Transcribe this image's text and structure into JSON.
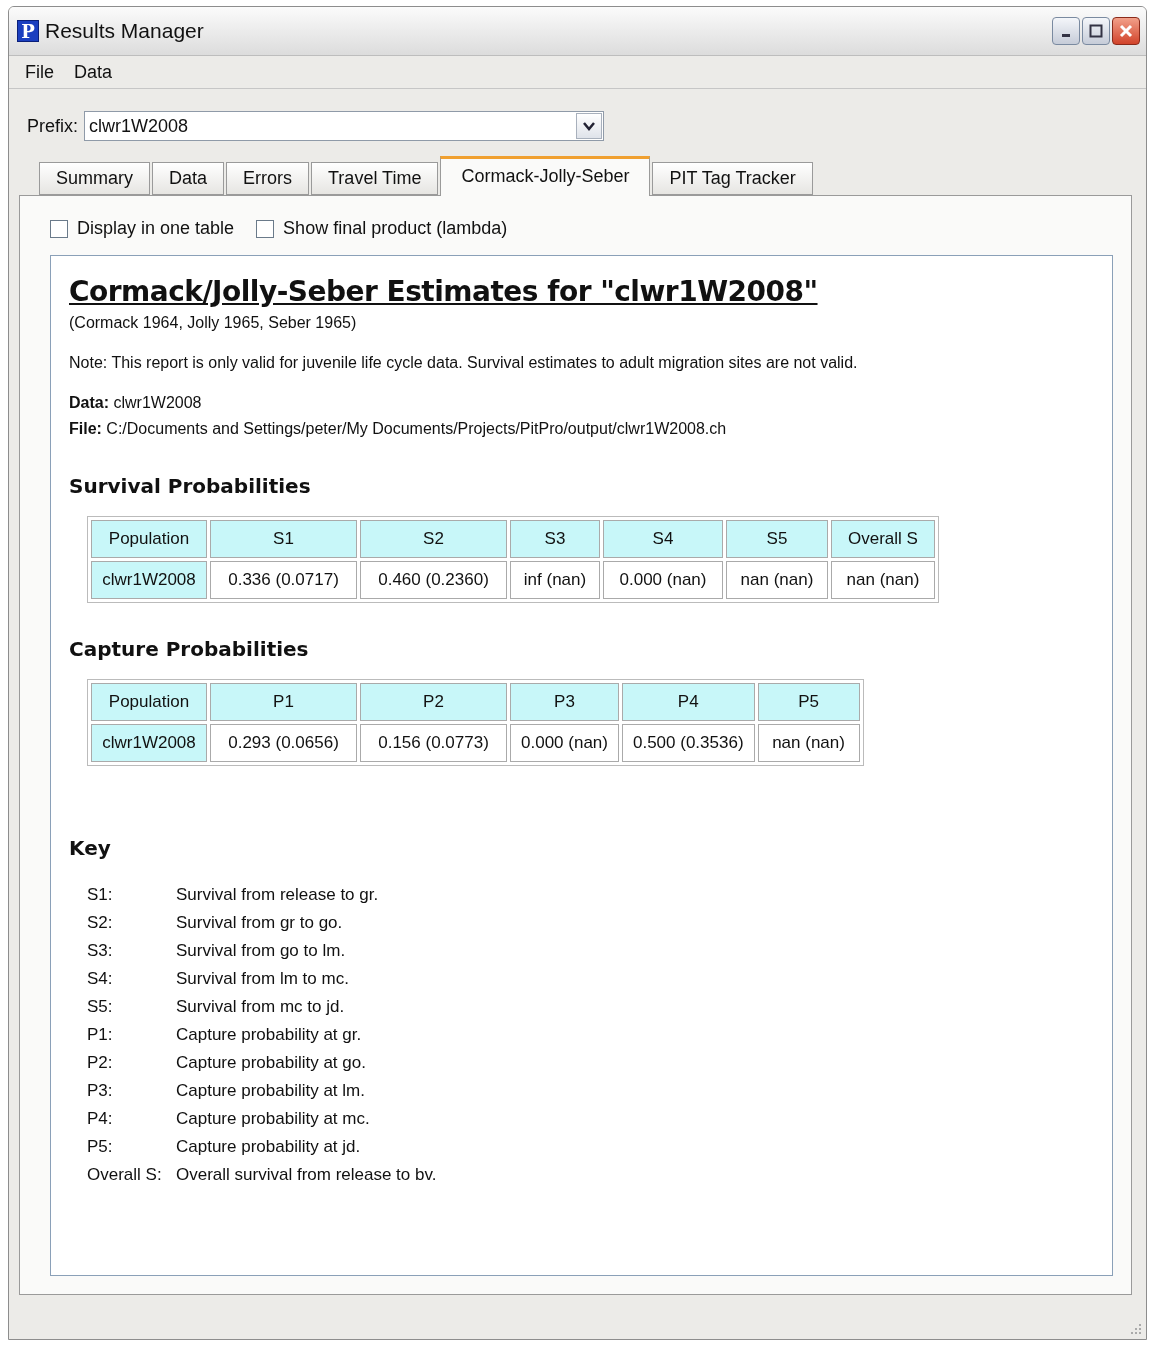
{
  "window": {
    "icon_letter": "P",
    "title": "Results Manager"
  },
  "menu": [
    "File",
    "Data"
  ],
  "prefix": {
    "label": "Prefix:",
    "value": "clwr1W2008"
  },
  "tabs": [
    {
      "label": "Summary",
      "selected": false
    },
    {
      "label": "Data",
      "selected": false
    },
    {
      "label": "Errors",
      "selected": false
    },
    {
      "label": "Travel Time",
      "selected": false
    },
    {
      "label": "Cormack-Jolly-Seber",
      "selected": true
    },
    {
      "label": "PIT Tag Tracker",
      "selected": false
    }
  ],
  "options": [
    {
      "label": "Display in one table",
      "checked": false
    },
    {
      "label": "Show final product (lambda)",
      "checked": false
    }
  ],
  "report": {
    "title": "Cormack/Jolly-Seber Estimates for \"clwr1W2008\"",
    "citation": "(Cormack 1964, Jolly 1965, Seber 1965)",
    "note": "Note: This report is only valid for juvenile life cycle data. Survival estimates to adult migration sites are not valid.",
    "data_line": "**Data:** clwr1W2008",
    "file_line": "**File:** C:/Documents and Settings/peter/My Documents/Projects/PitPro/output/clwr1W2008.ch",
    "sections": [
      {
        "heading": "Survival Probabilities",
        "table": {
          "columns": [
            "Population",
            "S1",
            "S2",
            "S3",
            "S4",
            "S5",
            "Overall S"
          ],
          "rows": [
            [
              "clwr1W2008",
              "0.336 (0.0717)",
              "0.460 (0.2360)",
              "inf (nan)",
              "0.000 (nan)",
              "nan (nan)",
              "nan (nan)"
            ]
          ]
        }
      },
      {
        "heading": "Capture Probabilities",
        "table": {
          "columns": [
            "Population",
            "P1",
            "P2",
            "P3",
            "P4",
            "P5"
          ],
          "rows": [
            [
              "clwr1W2008",
              "0.293 (0.0656)",
              "0.156 (0.0773)",
              "0.000 (nan)",
              "0.500 (0.3536)",
              "nan (nan)"
            ]
          ]
        }
      }
    ],
    "key": {
      "heading": "Key",
      "items": [
        {
          "term": "S1:",
          "description": "Survival from release to gr."
        },
        {
          "term": "S2:",
          "description": "Survival from gr to go."
        },
        {
          "term": "S3:",
          "description": "Survival from go to lm."
        },
        {
          "term": "S4:",
          "description": "Survival from lm to mc."
        },
        {
          "term": "S5:",
          "description": "Survival from mc to jd."
        },
        {
          "term": "P1:",
          "description": "Capture probability at gr."
        },
        {
          "term": "P2:",
          "description": "Capture probability at go."
        },
        {
          "term": "P3:",
          "description": "Capture probability at lm."
        },
        {
          "term": "P4:",
          "description": "Capture probability at mc."
        },
        {
          "term": "P5:",
          "description": "Capture probability at jd."
        },
        {
          "term": "Overall S:",
          "description": "Overall survival from release to bv."
        }
      ]
    }
  }
}
